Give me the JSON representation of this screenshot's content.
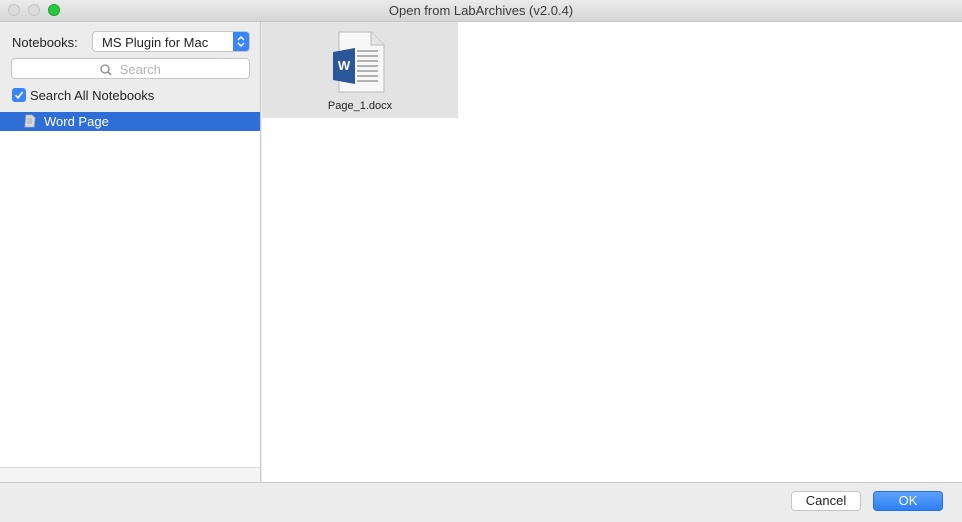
{
  "window": {
    "title": "Open from LabArchives (v2.0.4)"
  },
  "sidebar": {
    "notebooks_label": "Notebooks:",
    "notebook_selected": "MS Plugin for Mac",
    "search_placeholder": "Search",
    "search_all_label": "Search All Notebooks",
    "search_all_checked": true,
    "items": [
      {
        "label": "Word Page",
        "selected": true,
        "icon": "page-icon"
      }
    ]
  },
  "content": {
    "files": [
      {
        "name": "Page_1.docx",
        "icon": "word-document-icon"
      }
    ]
  },
  "footer": {
    "cancel_label": "Cancel",
    "ok_label": "OK"
  },
  "colors": {
    "accent": "#3b86f7",
    "selection": "#2f6ed6",
    "word_blue": "#2b579a"
  }
}
